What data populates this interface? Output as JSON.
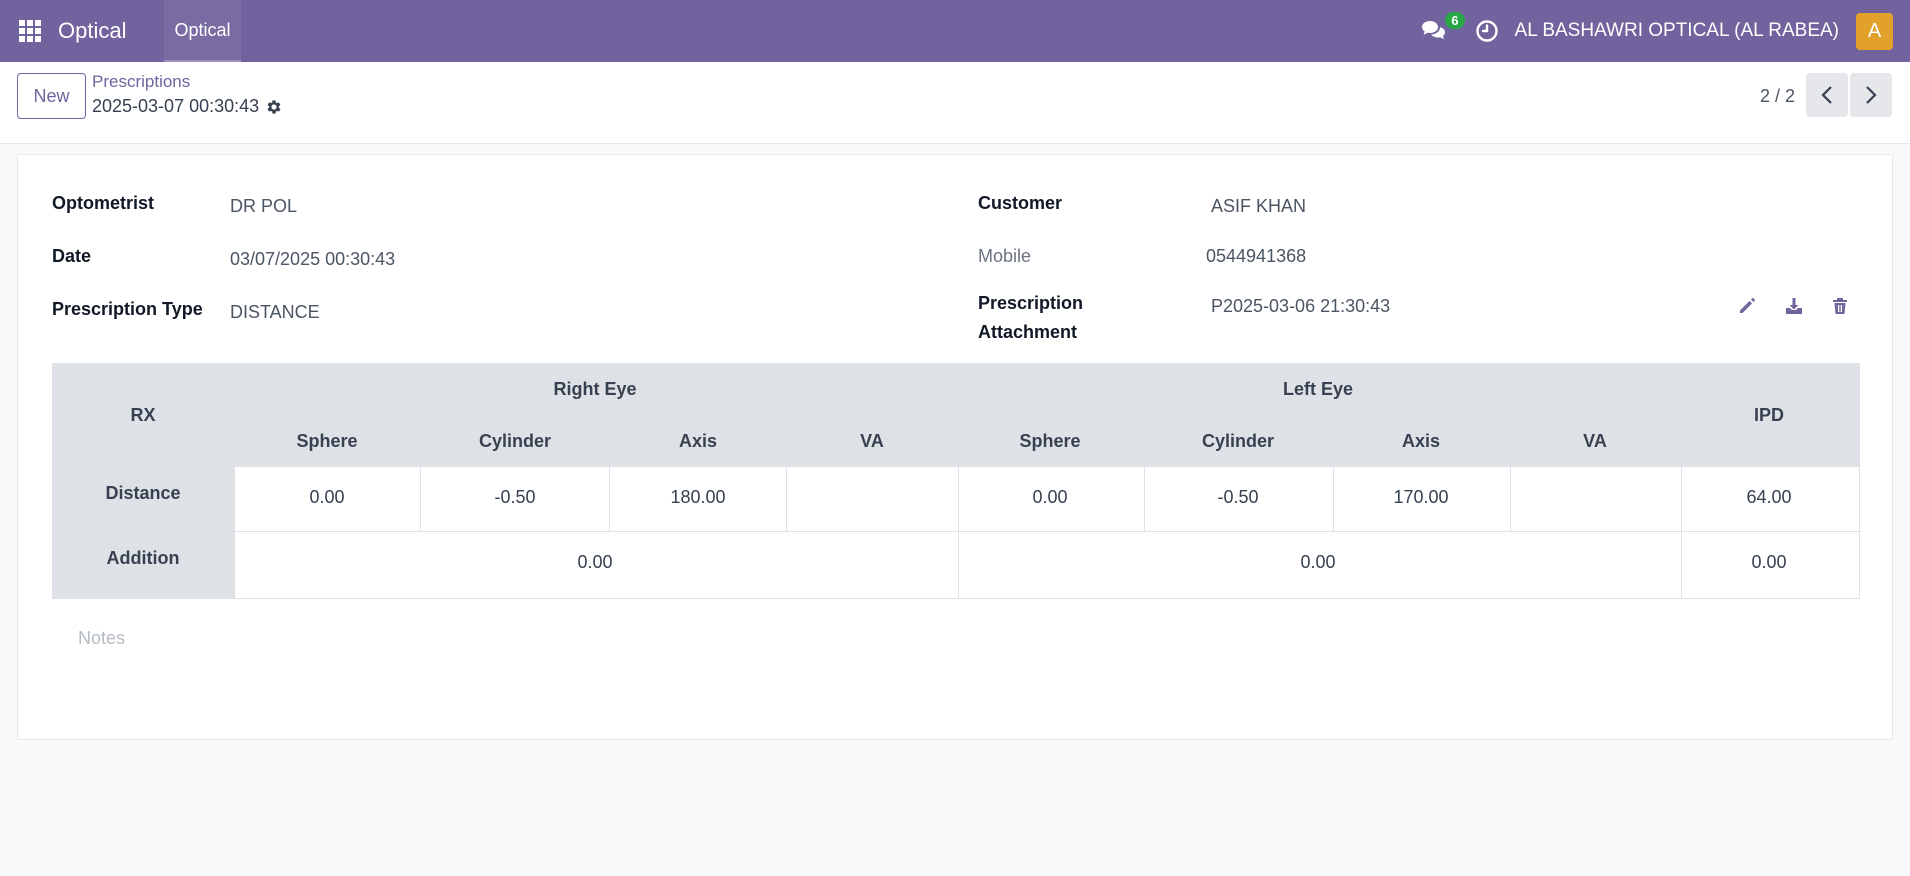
{
  "navbar": {
    "app_name": "Optical",
    "menu_item": "Optical",
    "messages_count": "6",
    "company": "AL BASHAWRI OPTICAL (AL RABEA)",
    "avatar_letter": "A",
    "color": "#71639e"
  },
  "control_panel": {
    "new_label": "New",
    "breadcrumb": "Prescriptions",
    "record_name": "2025-03-07 00:30:43",
    "pager": "2 / 2"
  },
  "form": {
    "optometrist_label": "Optometrist",
    "optometrist_value": "DR POL",
    "date_label": "Date",
    "date_value": "03/07/2025 00:30:43",
    "type_label": "Prescription Type",
    "type_value": "DISTANCE",
    "customer_label": "Customer",
    "customer_value": "ASIF KHAN",
    "mobile_label": "Mobile",
    "mobile_value": "0544941368",
    "attachment_label_1": "Prescription",
    "attachment_label_2": "Attachment",
    "attachment_value": "P2025-03-06 21:30:43"
  },
  "rx_table": {
    "rx_header": "RX",
    "right_eye": "Right Eye",
    "left_eye": "Left Eye",
    "ipd": "IPD",
    "columns": [
      "Sphere",
      "Cylinder",
      "Axis",
      "VA",
      "Sphere",
      "Cylinder",
      "Axis",
      "VA"
    ],
    "distance_label": "Distance",
    "addition_label": "Addition",
    "distance": {
      "right_sphere": "0.00",
      "right_cylinder": "-0.50",
      "right_axis": "180.00",
      "right_va": "",
      "left_sphere": "0.00",
      "left_cylinder": "-0.50",
      "left_axis": "170.00",
      "left_va": "",
      "ipd": "64.00"
    },
    "addition": {
      "right": "0.00",
      "left": "0.00",
      "ipd": "0.00"
    }
  },
  "notes_placeholder": "Notes"
}
